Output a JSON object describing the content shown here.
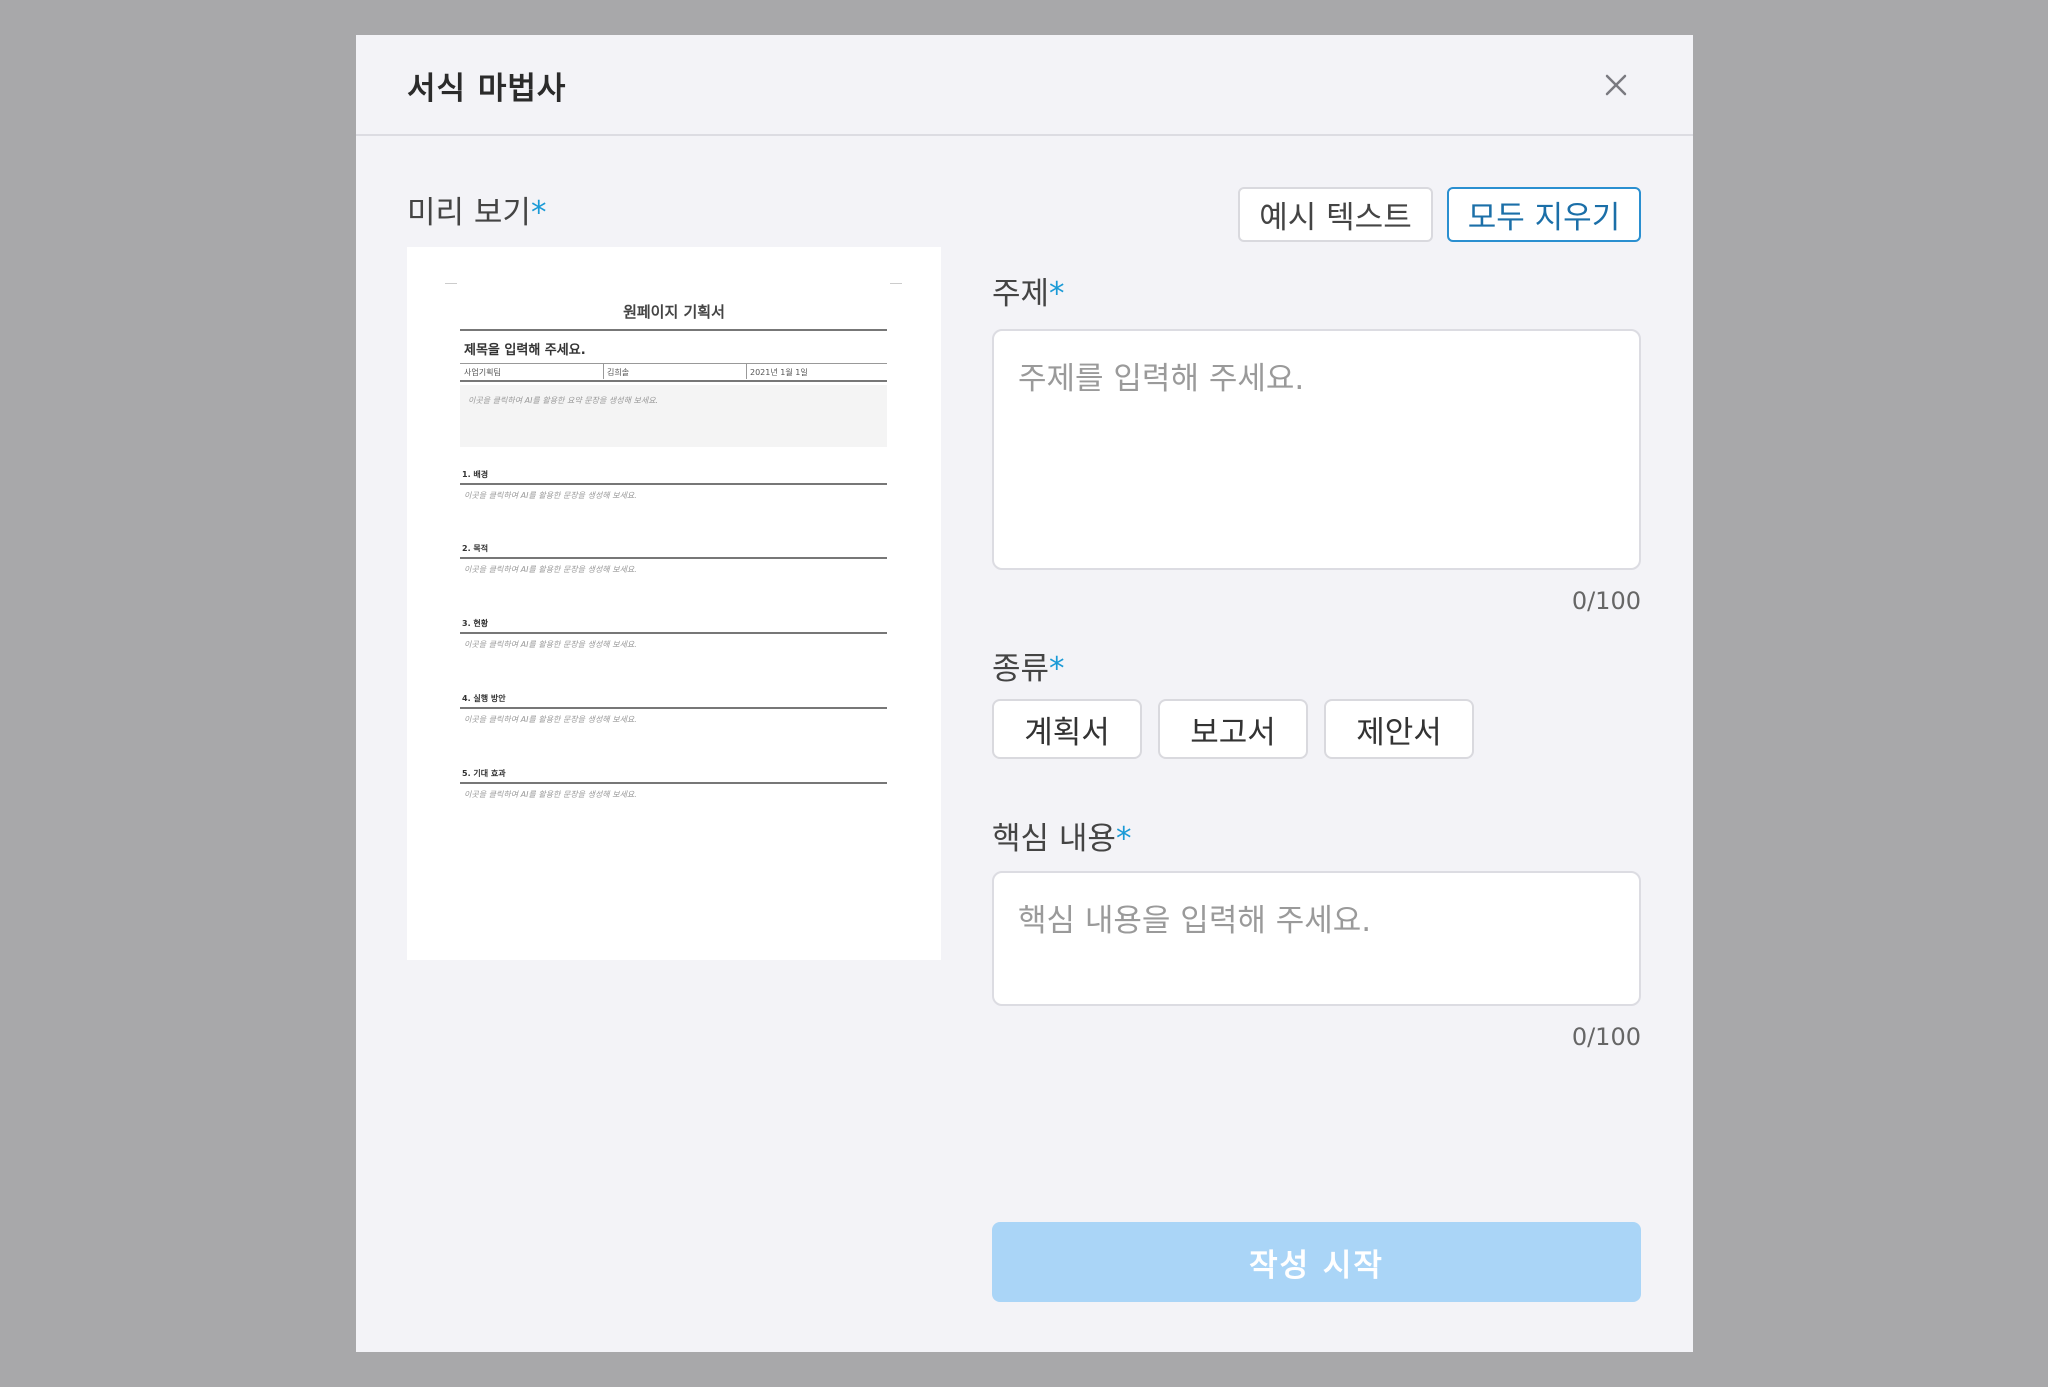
{
  "dialog": {
    "title": "서식 마법사"
  },
  "preview": {
    "label": "미리 보기",
    "required_mark": "*",
    "document": {
      "title": "원페이지 기획서",
      "subtitle": "제목을 입력해 주세요.",
      "meta": [
        "사업기획팀",
        "김희솔",
        "2021년 1월 1일"
      ],
      "summary_hint": "이곳을 클릭하여 AI를 활용한 요약 문장을 생성해 보세요.",
      "sections": [
        {
          "heading": "1. 배경",
          "body": "이곳을 클릭하여 AI를 활용한 문장을 생성해 보세요."
        },
        {
          "heading": "2. 목적",
          "body": "이곳을 클릭하여 AI를 활용한 문장을 생성해 보세요."
        },
        {
          "heading": "3. 현황",
          "body": "이곳을 클릭하여 AI를 활용한 문장을 생성해 보세요."
        },
        {
          "heading": "4. 실행 방안",
          "body": "이곳을 클릭하여 AI를 활용한 문장을 생성해 보세요."
        },
        {
          "heading": "5. 기대 효과",
          "body": "이곳을 클릭하여 AI를 활용한 문장을 생성해 보세요."
        }
      ]
    }
  },
  "actions": {
    "sample_text": "예시 텍스트",
    "clear_all": "모두 지우기",
    "start": "작성 시작"
  },
  "topic": {
    "label": "주제",
    "required_mark": "*",
    "placeholder": "주제를 입력해 주세요.",
    "counter": "0/100"
  },
  "type": {
    "label": "종류",
    "required_mark": "*",
    "options": [
      "계획서",
      "보고서",
      "제안서"
    ]
  },
  "key_content": {
    "label": "핵심 내용",
    "required_mark": "*",
    "placeholder": "핵심 내용을 입력해 주세요.",
    "counter": "0/100"
  },
  "colors": {
    "accent": "#1a9ad6",
    "start_button_disabled": "#aad5f7",
    "overlay": "#a8a8aa"
  }
}
